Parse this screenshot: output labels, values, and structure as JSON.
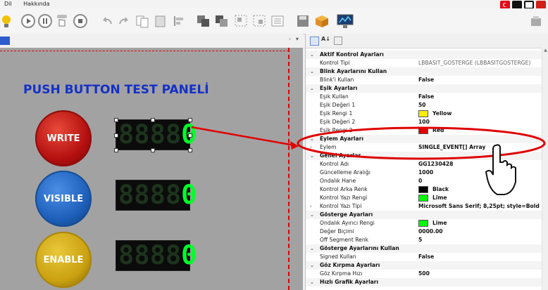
{
  "menu": {
    "items": [
      "Dil",
      "Hakkında"
    ]
  },
  "panel": {
    "title": "PUSH BUTTON TEST PANELİ",
    "buttons": [
      {
        "label": "WRITE",
        "color": "#c41010"
      },
      {
        "label": "VISIBLE",
        "color": "#1d5fb8"
      },
      {
        "label": "ENABLE",
        "color": "#c9a010"
      }
    ],
    "display_digits": [
      "8",
      "8",
      "8",
      "8",
      "0"
    ]
  },
  "property_grid": {
    "rows": [
      {
        "type": "cat",
        "label": "Aktif Kontrol Ayarları"
      },
      {
        "type": "prop",
        "label": "Kontrol Tipi",
        "value": "LBBASIT_GOSTERGE (LBBASITGOSTERGE)",
        "plain": true
      },
      {
        "type": "cat",
        "label": "Blink Ayarlarını Kullan"
      },
      {
        "type": "prop",
        "label": "Blink'i Kullan",
        "value": "False"
      },
      {
        "type": "cat",
        "label": "Eşik Ayarları"
      },
      {
        "type": "prop",
        "label": "Eşik Kullan",
        "value": "False"
      },
      {
        "type": "prop",
        "label": "Eşik Değeri 1",
        "value": "50"
      },
      {
        "type": "prop",
        "label": "Eşik Rengi 1",
        "value": "Yellow",
        "swatch": "#ffee00"
      },
      {
        "type": "prop",
        "label": "Eşik Değeri 2",
        "value": "100"
      },
      {
        "type": "prop",
        "label": "Eşik Rengi 2",
        "value": "Red",
        "swatch": "#e00000"
      },
      {
        "type": "cat",
        "label": "Eylem Ayarları"
      },
      {
        "type": "prop",
        "label": "Eylem",
        "value": "SINGLE_EVENT[] Array",
        "expand": true
      },
      {
        "type": "cat",
        "label": "Genel Ayarlar"
      },
      {
        "type": "prop",
        "label": "Kontrol Adı",
        "value": "GG1230428"
      },
      {
        "type": "prop",
        "label": "Güncelleme Aralığı",
        "value": "1000"
      },
      {
        "type": "prop",
        "label": "Ondalık Hane",
        "value": "0"
      },
      {
        "type": "prop",
        "label": "Kontrol Arka Renk",
        "value": "Black",
        "swatch": "#000000"
      },
      {
        "type": "prop",
        "label": "Kontrol Yazı Rengi",
        "value": "Lime",
        "swatch": "#00ff00"
      },
      {
        "type": "prop",
        "label": "Kontrol Yazı Tipi",
        "value": "Microsoft Sans Serif; 8,25pt; style=Bold",
        "expand": true
      },
      {
        "type": "cat",
        "label": "Gösterge Ayarları"
      },
      {
        "type": "prop",
        "label": "Ondalık Ayırıcı Rengi",
        "value": "Lime",
        "swatch": "#00ff00"
      },
      {
        "type": "prop",
        "label": "Değer Biçimi",
        "value": "0000.00"
      },
      {
        "type": "prop",
        "label": "Off Segment Renk",
        "value": "5"
      },
      {
        "type": "cat",
        "label": "Gösterge Ayarlarını Kullan"
      },
      {
        "type": "prop",
        "label": "Signed Kullan",
        "value": "False"
      },
      {
        "type": "cat",
        "label": "Göz Kırpma Ayarları"
      },
      {
        "type": "prop",
        "label": "Göz Kırpma Hızı",
        "value": "500"
      },
      {
        "type": "cat",
        "label": "Hızlı Grafik Ayarları"
      }
    ]
  },
  "colors": {
    "accent_red": "#e00000",
    "canvas_bg": "#a2a2a2",
    "title_blue": "#1530c8"
  }
}
